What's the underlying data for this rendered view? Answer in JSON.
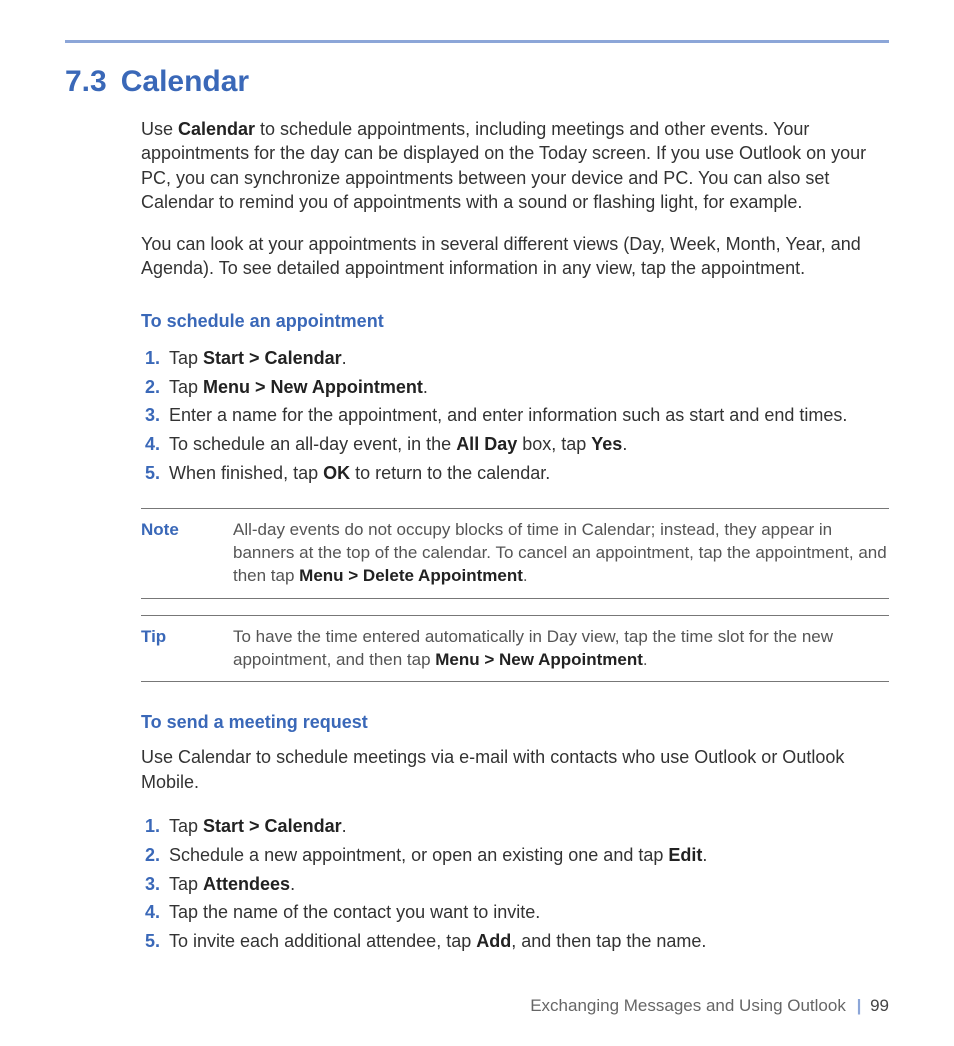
{
  "section": {
    "number": "7.3",
    "title": "Calendar"
  },
  "intro": {
    "p1_pre": "Use ",
    "p1_b": "Calendar",
    "p1_post": " to schedule appointments, including meetings and other events. Your appointments for the day can be displayed on the Today screen. If you use Outlook on your PC, you can synchronize appointments between your device and PC. You can also set Calendar to remind you of appointments with a sound or flashing light, for example.",
    "p2": "You can look at your appointments in several different views (Day, Week, Month, Year, and Agenda). To see detailed appointment information in any view, tap the appointment."
  },
  "schedule": {
    "heading": "To schedule an appointment",
    "s1_pre": "Tap ",
    "s1_b": "Start > Calendar",
    "s1_post": ".",
    "s2_pre": "Tap ",
    "s2_b": "Menu > New Appointment",
    "s2_post": ".",
    "s3": "Enter a name for the appointment, and enter information such as start and end times.",
    "s4_pre": "To schedule an all-day event, in the ",
    "s4_b1": "All Day",
    "s4_mid": " box, tap ",
    "s4_b2": "Yes",
    "s4_post": ".",
    "s5_pre": "When finished, tap ",
    "s5_b": "OK",
    "s5_post": " to return to the calendar."
  },
  "note": {
    "label": "Note",
    "pre": "All-day events do not occupy blocks of time in Calendar; instead, they appear in banners at the top of the calendar. To cancel an appointment, tap the appointment, and then tap ",
    "b": "Menu > Delete Appointment",
    "post": "."
  },
  "tip": {
    "label": "Tip",
    "pre": "To have the time entered automatically in Day view, tap the time slot for the new appointment, and then tap ",
    "b": "Menu > New Appointment",
    "post": "."
  },
  "meeting": {
    "heading": "To send a meeting request",
    "intro": "Use Calendar to schedule meetings via e-mail with contacts who use Outlook or Outlook Mobile.",
    "s1_pre": "Tap ",
    "s1_b": "Start > Calendar",
    "s1_post": ".",
    "s2_pre": "Schedule a new appointment, or open an existing one and tap ",
    "s2_b": "Edit",
    "s2_post": ".",
    "s3_pre": "Tap ",
    "s3_b": "Attendees",
    "s3_post": ".",
    "s4": "Tap the name of the contact you want to invite.",
    "s5_pre": "To invite each additional attendee, tap ",
    "s5_b": "Add",
    "s5_post": ", and then tap the name."
  },
  "footer": {
    "chapter": "Exchanging Messages and Using Outlook",
    "page": "99"
  }
}
